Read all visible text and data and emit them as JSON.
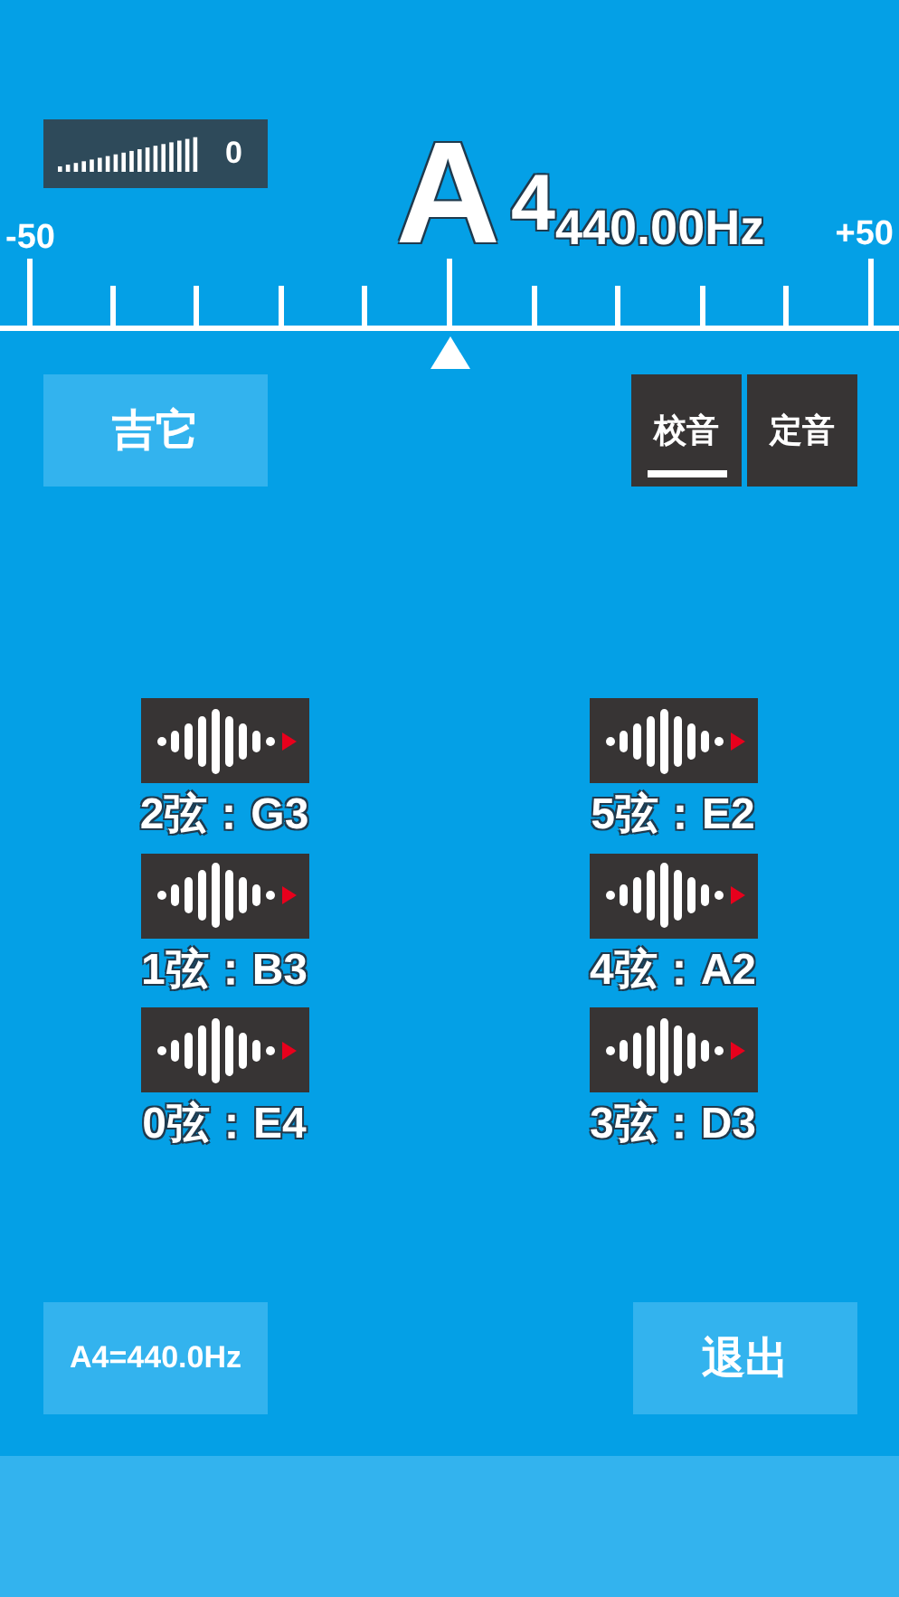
{
  "volume": {
    "reading": "0"
  },
  "note": {
    "letter": "A",
    "octave": "4",
    "frequency": "440.00Hz"
  },
  "scale": {
    "min_label": "-50",
    "max_label": "+50"
  },
  "instrument_button": "吉它",
  "mode_tabs": [
    {
      "label": "校音",
      "selected": true
    },
    {
      "label": "定音",
      "selected": false
    }
  ],
  "strings": [
    {
      "label": "2弦：G3"
    },
    {
      "label": "5弦：E2"
    },
    {
      "label": "1弦：B3"
    },
    {
      "label": "4弦：A2"
    },
    {
      "label": "0弦：E4"
    },
    {
      "label": "3弦：D3"
    }
  ],
  "reference_button": "A4=440.0Hz",
  "exit_button": "退出"
}
